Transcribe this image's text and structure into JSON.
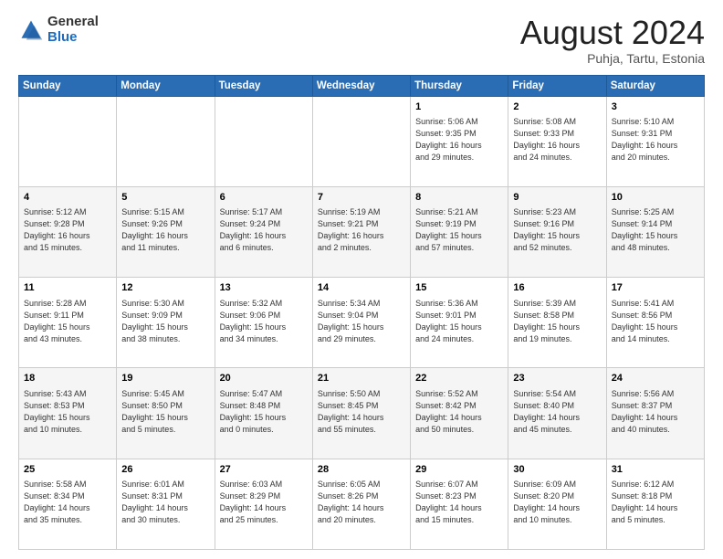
{
  "logo": {
    "general": "General",
    "blue": "Blue"
  },
  "title": "August 2024",
  "location": "Puhja, Tartu, Estonia",
  "days_of_week": [
    "Sunday",
    "Monday",
    "Tuesday",
    "Wednesday",
    "Thursday",
    "Friday",
    "Saturday"
  ],
  "weeks": [
    [
      {
        "day": "",
        "info": ""
      },
      {
        "day": "",
        "info": ""
      },
      {
        "day": "",
        "info": ""
      },
      {
        "day": "",
        "info": ""
      },
      {
        "day": "1",
        "info": "Sunrise: 5:06 AM\nSunset: 9:35 PM\nDaylight: 16 hours\nand 29 minutes."
      },
      {
        "day": "2",
        "info": "Sunrise: 5:08 AM\nSunset: 9:33 PM\nDaylight: 16 hours\nand 24 minutes."
      },
      {
        "day": "3",
        "info": "Sunrise: 5:10 AM\nSunset: 9:31 PM\nDaylight: 16 hours\nand 20 minutes."
      }
    ],
    [
      {
        "day": "4",
        "info": "Sunrise: 5:12 AM\nSunset: 9:28 PM\nDaylight: 16 hours\nand 15 minutes."
      },
      {
        "day": "5",
        "info": "Sunrise: 5:15 AM\nSunset: 9:26 PM\nDaylight: 16 hours\nand 11 minutes."
      },
      {
        "day": "6",
        "info": "Sunrise: 5:17 AM\nSunset: 9:24 PM\nDaylight: 16 hours\nand 6 minutes."
      },
      {
        "day": "7",
        "info": "Sunrise: 5:19 AM\nSunset: 9:21 PM\nDaylight: 16 hours\nand 2 minutes."
      },
      {
        "day": "8",
        "info": "Sunrise: 5:21 AM\nSunset: 9:19 PM\nDaylight: 15 hours\nand 57 minutes."
      },
      {
        "day": "9",
        "info": "Sunrise: 5:23 AM\nSunset: 9:16 PM\nDaylight: 15 hours\nand 52 minutes."
      },
      {
        "day": "10",
        "info": "Sunrise: 5:25 AM\nSunset: 9:14 PM\nDaylight: 15 hours\nand 48 minutes."
      }
    ],
    [
      {
        "day": "11",
        "info": "Sunrise: 5:28 AM\nSunset: 9:11 PM\nDaylight: 15 hours\nand 43 minutes."
      },
      {
        "day": "12",
        "info": "Sunrise: 5:30 AM\nSunset: 9:09 PM\nDaylight: 15 hours\nand 38 minutes."
      },
      {
        "day": "13",
        "info": "Sunrise: 5:32 AM\nSunset: 9:06 PM\nDaylight: 15 hours\nand 34 minutes."
      },
      {
        "day": "14",
        "info": "Sunrise: 5:34 AM\nSunset: 9:04 PM\nDaylight: 15 hours\nand 29 minutes."
      },
      {
        "day": "15",
        "info": "Sunrise: 5:36 AM\nSunset: 9:01 PM\nDaylight: 15 hours\nand 24 minutes."
      },
      {
        "day": "16",
        "info": "Sunrise: 5:39 AM\nSunset: 8:58 PM\nDaylight: 15 hours\nand 19 minutes."
      },
      {
        "day": "17",
        "info": "Sunrise: 5:41 AM\nSunset: 8:56 PM\nDaylight: 15 hours\nand 14 minutes."
      }
    ],
    [
      {
        "day": "18",
        "info": "Sunrise: 5:43 AM\nSunset: 8:53 PM\nDaylight: 15 hours\nand 10 minutes."
      },
      {
        "day": "19",
        "info": "Sunrise: 5:45 AM\nSunset: 8:50 PM\nDaylight: 15 hours\nand 5 minutes."
      },
      {
        "day": "20",
        "info": "Sunrise: 5:47 AM\nSunset: 8:48 PM\nDaylight: 15 hours\nand 0 minutes."
      },
      {
        "day": "21",
        "info": "Sunrise: 5:50 AM\nSunset: 8:45 PM\nDaylight: 14 hours\nand 55 minutes."
      },
      {
        "day": "22",
        "info": "Sunrise: 5:52 AM\nSunset: 8:42 PM\nDaylight: 14 hours\nand 50 minutes."
      },
      {
        "day": "23",
        "info": "Sunrise: 5:54 AM\nSunset: 8:40 PM\nDaylight: 14 hours\nand 45 minutes."
      },
      {
        "day": "24",
        "info": "Sunrise: 5:56 AM\nSunset: 8:37 PM\nDaylight: 14 hours\nand 40 minutes."
      }
    ],
    [
      {
        "day": "25",
        "info": "Sunrise: 5:58 AM\nSunset: 8:34 PM\nDaylight: 14 hours\nand 35 minutes."
      },
      {
        "day": "26",
        "info": "Sunrise: 6:01 AM\nSunset: 8:31 PM\nDaylight: 14 hours\nand 30 minutes."
      },
      {
        "day": "27",
        "info": "Sunrise: 6:03 AM\nSunset: 8:29 PM\nDaylight: 14 hours\nand 25 minutes."
      },
      {
        "day": "28",
        "info": "Sunrise: 6:05 AM\nSunset: 8:26 PM\nDaylight: 14 hours\nand 20 minutes."
      },
      {
        "day": "29",
        "info": "Sunrise: 6:07 AM\nSunset: 8:23 PM\nDaylight: 14 hours\nand 15 minutes."
      },
      {
        "day": "30",
        "info": "Sunrise: 6:09 AM\nSunset: 8:20 PM\nDaylight: 14 hours\nand 10 minutes."
      },
      {
        "day": "31",
        "info": "Sunrise: 6:12 AM\nSunset: 8:18 PM\nDaylight: 14 hours\nand 5 minutes."
      }
    ]
  ]
}
